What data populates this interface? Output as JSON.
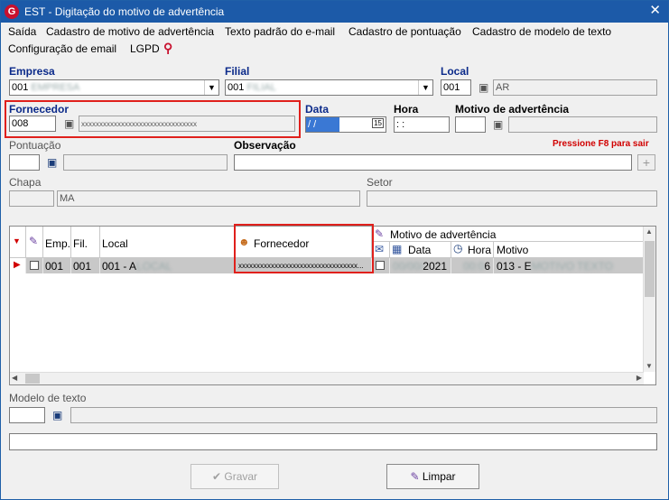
{
  "window": {
    "title": "EST - Digitação do motivo de advertência",
    "close": "✕",
    "logo": "G"
  },
  "menu": {
    "items": [
      "Saída",
      "Cadastro de motivo de advertência",
      "Texto padrão do e-mail",
      "Cadastro de pontuação",
      "Cadastro de modelo de texto",
      "Configuração de email",
      "LGPD"
    ]
  },
  "form": {
    "empresa_label": "Empresa",
    "empresa_value": "001",
    "filial_label": "Filial",
    "filial_value": "001",
    "local_label": "Local",
    "local_code": "001",
    "local_name": "AR",
    "fornecedor_label": "Fornecedor",
    "fornecedor_code": "008",
    "fornecedor_name": "xxxxxxxxxxxxxxxxxxxxxxxxxxxxxxxx",
    "data_label": "Data",
    "data_value": "/ /",
    "data_cal": "15",
    "hora_label": "Hora",
    "hora_value": ": :",
    "motivo_label": "Motivo de advertência",
    "pontuacao_label": "Pontuação",
    "observacao_label": "Observação",
    "f8_hint": "Pressione F8 para sair",
    "plus": "+",
    "chapa_label": "Chapa",
    "chapa_name": "MA",
    "setor_label": "Setor",
    "modelo_label": "Modelo de texto"
  },
  "grid": {
    "headers": {
      "emp": "Emp.",
      "fil": "Fil.",
      "local": "Local",
      "fornecedor": "Fornecedor",
      "motivo_group": "Motivo de advertência",
      "data": "Data",
      "hora": "Hora",
      "motivo": "Motivo"
    },
    "row": {
      "emp": "001",
      "fil": "001",
      "local": "001 - A",
      "fornecedor": "xxxxxxxxxxxxxxxxxxxxxxxxxxxxxxxxx",
      "fornecedor_more": "...",
      "data": "2021",
      "hora": "6",
      "motivo": "013 - E"
    }
  },
  "buttons": {
    "gravar": "Gravar",
    "limpar": "Limpar"
  },
  "colors": {
    "titlebar": "#1c5aa8",
    "label_blue": "#0b2a8a",
    "highlight": "#e0201c",
    "f8": "#d10000"
  }
}
